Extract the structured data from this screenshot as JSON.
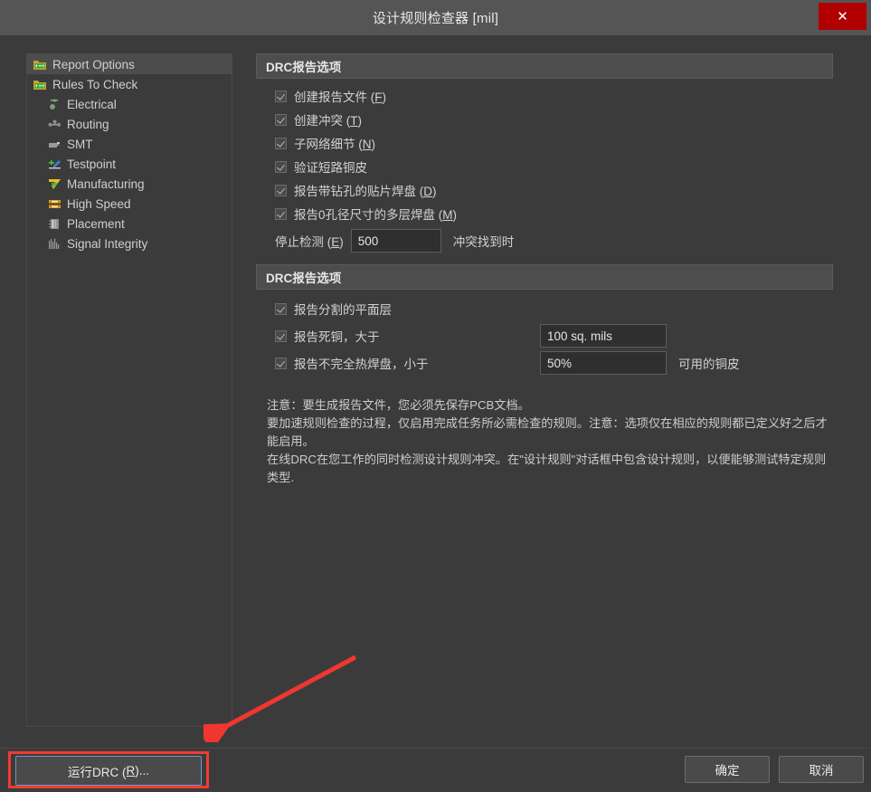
{
  "window": {
    "title": "设计规则检查器 [mil]",
    "close_label": "✕",
    "close_icon": "close-icon"
  },
  "sidebar": {
    "items": [
      {
        "label": "Report Options",
        "icon": "folder-arrows-icon",
        "level": 0,
        "selected": true
      },
      {
        "label": "Rules To Check",
        "icon": "folder-arrows-icon",
        "level": 0,
        "selected": false
      },
      {
        "label": "Electrical",
        "icon": "electrical-icon",
        "level": 1,
        "selected": false
      },
      {
        "label": "Routing",
        "icon": "routing-icon",
        "level": 1,
        "selected": false
      },
      {
        "label": "SMT",
        "icon": "smt-icon",
        "level": 1,
        "selected": false
      },
      {
        "label": "Testpoint",
        "icon": "testpoint-icon",
        "level": 1,
        "selected": false
      },
      {
        "label": "Manufacturing",
        "icon": "manufacturing-icon",
        "level": 1,
        "selected": false
      },
      {
        "label": "High Speed",
        "icon": "high-speed-icon",
        "level": 1,
        "selected": false
      },
      {
        "label": "Placement",
        "icon": "placement-icon",
        "level": 1,
        "selected": false
      },
      {
        "label": "Signal Integrity",
        "icon": "signal-integrity-icon",
        "level": 1,
        "selected": false
      }
    ]
  },
  "section1": {
    "header": "DRC报告选项",
    "options": [
      {
        "label": "创建报告文件 (",
        "accel": "F",
        "tail": ")",
        "checked": true
      },
      {
        "label": "创建冲突 (",
        "accel": "T",
        "tail": ")",
        "checked": true
      },
      {
        "label": "子网络细节 (",
        "accel": "N",
        "tail": ")",
        "checked": true
      },
      {
        "label": "验证短路铜皮",
        "accel": "",
        "tail": "",
        "checked": true
      },
      {
        "label": "报告带钻孔的贴片焊盘 (",
        "accel": "D",
        "tail": ")",
        "checked": true
      },
      {
        "label": "报告0孔径尺寸的多层焊盘 (",
        "accel": "M",
        "tail": ")",
        "checked": true
      }
    ],
    "stop_label_pre": "停止检测 (",
    "stop_accel": "E",
    "stop_label_post": ")",
    "stop_value": "500",
    "stop_suffix": "冲突找到时"
  },
  "section2": {
    "header": "DRC报告选项",
    "rows": [
      {
        "label": "报告分割的平面层",
        "checked": true,
        "value": null,
        "suffix": ""
      },
      {
        "label": "报告死铜，大于",
        "checked": true,
        "value": "100 sq. mils",
        "suffix": ""
      },
      {
        "label": "报告不完全热焊盘，小于",
        "checked": true,
        "value": "50%",
        "suffix": "可用的铜皮"
      }
    ]
  },
  "note": {
    "lines": [
      "注意：要生成报告文件，您必须先保存PCB文档。",
      "要加速规则检查的过程，仅启用完成任务所必需检查的规则。注意：选项仅在相应的规则都已定义好之后才能启用。",
      "在线DRC在您工作的同时检测设计规则冲突。在\"设计规则\"对话框中包含设计规则，以便能够测试特定规则类型."
    ]
  },
  "footer": {
    "run_drc_pre": "运行DRC (",
    "run_drc_accel": "R",
    "run_drc_post": ")...",
    "ok": "确定",
    "cancel": "取消"
  },
  "annotation": {
    "highlight_color": "#f33a32",
    "arrow_color": "#f0372f",
    "arrow_target": "run-drc-button"
  }
}
